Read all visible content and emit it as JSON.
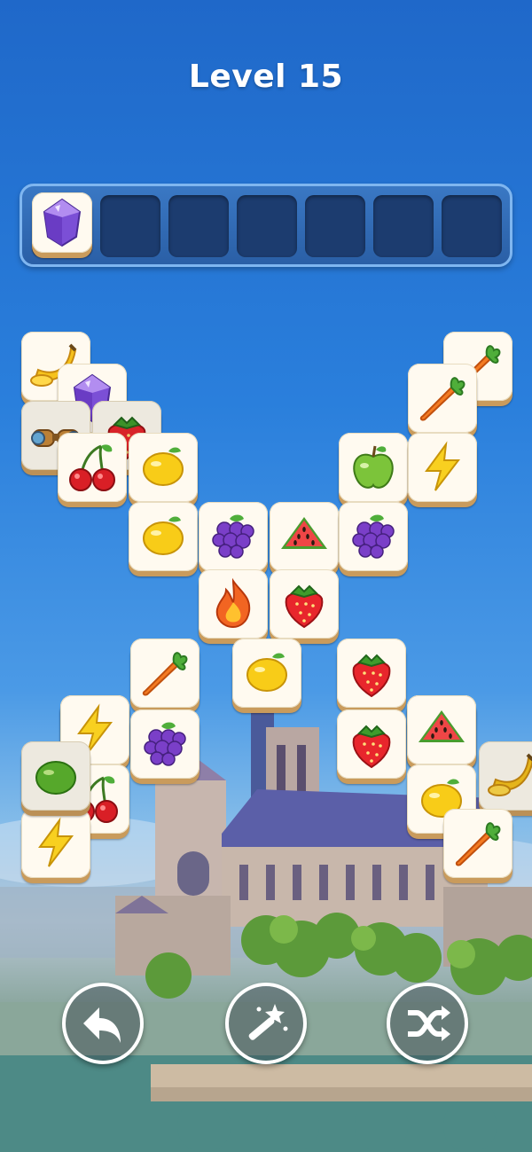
{
  "header": {
    "title": "Level 15"
  },
  "tray": {
    "capacity": 7,
    "filled": [
      "gem"
    ]
  },
  "board": {
    "tiles": [
      "banana",
      "carrot",
      "gem",
      "carrot",
      "binoculars",
      "strawberry",
      "cherry",
      "lemon",
      "apple",
      "bolt",
      "lemon",
      "grape",
      "watermelon",
      "grape",
      "fire",
      "strawberry",
      "lemon",
      "carrot",
      "strawberry",
      "banana",
      "fire",
      "bolt",
      "grape",
      "watermelon",
      "strawberry",
      "cherry",
      "lemon",
      "bolt",
      "banana",
      "lime",
      "carrot"
    ]
  },
  "controls": [
    {
      "name": "undo-button",
      "icon": "undo-arrow-icon"
    },
    {
      "name": "magic-wand-button",
      "icon": "magic-wand-icon"
    },
    {
      "name": "shuffle-button",
      "icon": "shuffle-icon"
    }
  ],
  "colors": {
    "sky_top": "#1f68c9",
    "tile_face": "#fffaf0",
    "tile_edge": "#c99b5c",
    "tray_slot": "#1c3c6f"
  }
}
